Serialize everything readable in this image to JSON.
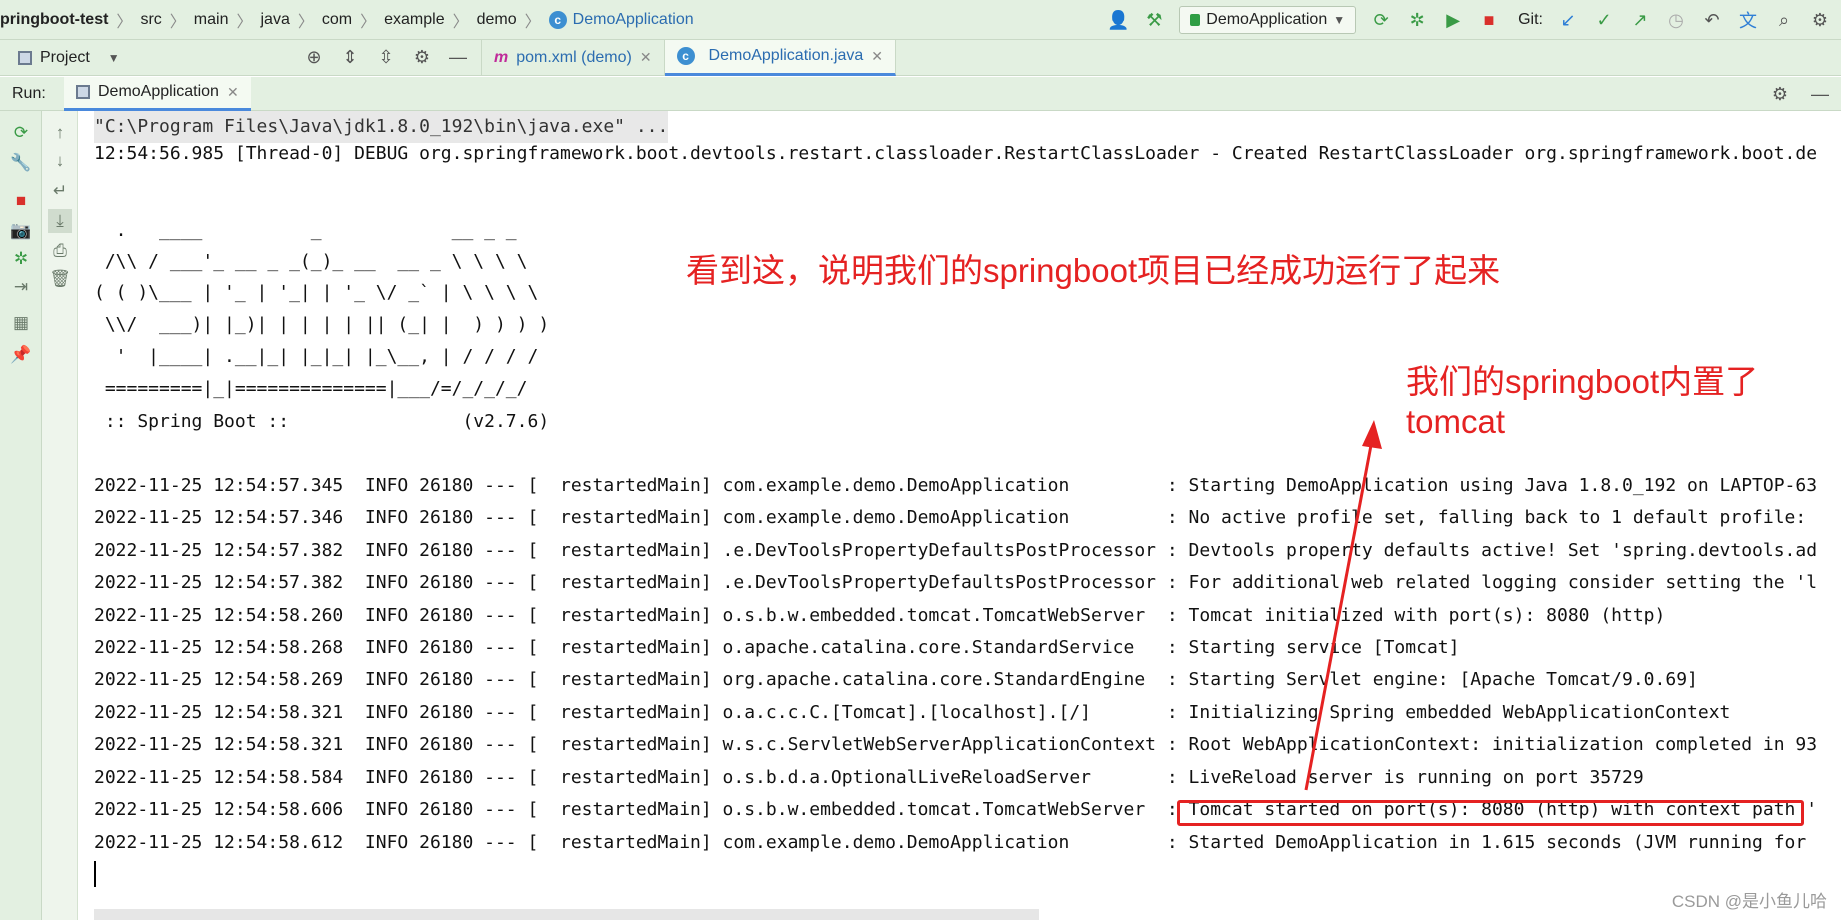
{
  "breadcrumb": {
    "items": [
      "pringboot-test",
      "src",
      "main",
      "java",
      "com",
      "example",
      "demo"
    ],
    "current": "DemoApplication"
  },
  "toolbar": {
    "run_config": "DemoApplication",
    "git_label": "Git:"
  },
  "project_panel": {
    "label": "Project"
  },
  "editor_tabs": [
    {
      "label": "pom.xml (demo)",
      "icon": "maven-icon"
    },
    {
      "label": "DemoApplication.java",
      "icon": "class-icon"
    }
  ],
  "run_panel": {
    "label": "Run:",
    "tab": "DemoApplication"
  },
  "console": {
    "lines": [
      "\"C:\\Program Files\\Java\\jdk1.8.0_192\\bin\\java.exe\" ...",
      "12:54:56.985 [Thread-0] DEBUG org.springframework.boot.devtools.restart.classloader.RestartClassLoader - Created RestartClassLoader org.springframework.boot.de",
      "",
      "  .   ____          _            __ _ _",
      " /\\\\ / ___'_ __ _ _(_)_ __  __ _ \\ \\ \\ \\",
      "( ( )\\___ | '_ | '_| | '_ \\/ _` | \\ \\ \\ \\",
      " \\\\/  ___)| |_)| | | | | || (_| |  ) ) ) )",
      "  '  |____| .__|_| |_|_| |_\\__, | / / / /",
      " =========|_|==============|___/=/_/_/_/",
      " :: Spring Boot ::                (v2.7.6)",
      "",
      "2022-11-25 12:54:57.345  INFO 26180 --- [  restartedMain] com.example.demo.DemoApplication         : Starting DemoApplication using Java 1.8.0_192 on LAPTOP-63",
      "2022-11-25 12:54:57.346  INFO 26180 --- [  restartedMain] com.example.demo.DemoApplication         : No active profile set, falling back to 1 default profile: ",
      "2022-11-25 12:54:57.382  INFO 26180 --- [  restartedMain] .e.DevToolsPropertyDefaultsPostProcessor : Devtools property defaults active! Set 'spring.devtools.ad",
      "2022-11-25 12:54:57.382  INFO 26180 --- [  restartedMain] .e.DevToolsPropertyDefaultsPostProcessor : For additional web related logging consider setting the 'l",
      "2022-11-25 12:54:58.260  INFO 26180 --- [  restartedMain] o.s.b.w.embedded.tomcat.TomcatWebServer  : Tomcat initialized with port(s): 8080 (http)",
      "2022-11-25 12:54:58.268  INFO 26180 --- [  restartedMain] o.apache.catalina.core.StandardService   : Starting service [Tomcat]",
      "2022-11-25 12:54:58.269  INFO 26180 --- [  restartedMain] org.apache.catalina.core.StandardEngine  : Starting Servlet engine: [Apache Tomcat/9.0.69]",
      "2022-11-25 12:54:58.321  INFO 26180 --- [  restartedMain] o.a.c.c.C.[Tomcat].[localhost].[/]       : Initializing Spring embedded WebApplicationContext",
      "2022-11-25 12:54:58.321  INFO 26180 --- [  restartedMain] w.s.c.ServletWebServerApplicationContext : Root WebApplicationContext: initialization completed in 93",
      "2022-11-25 12:54:58.584  INFO 26180 --- [  restartedMain] o.s.b.d.a.OptionalLiveReloadServer       : LiveReload server is running on port 35729",
      "2022-11-25 12:54:58.606  INFO 26180 --- [  restartedMain] o.s.b.w.embedded.tomcat.TomcatWebServer  : Tomcat started on port(s): 8080 (http) with context path '",
      "2022-11-25 12:54:58.612  INFO 26180 --- [  restartedMain] com.example.demo.DemoApplication         : Started DemoApplication in 1.615 seconds (JVM running for "
    ]
  },
  "annotations": {
    "note1": "看到这，说明我们的springboot项目已经成功运行了起来",
    "note2": "我们的springboot内置了\ntomcat",
    "color": "#e52222"
  },
  "watermark": "CSDN @是小鱼儿哈"
}
